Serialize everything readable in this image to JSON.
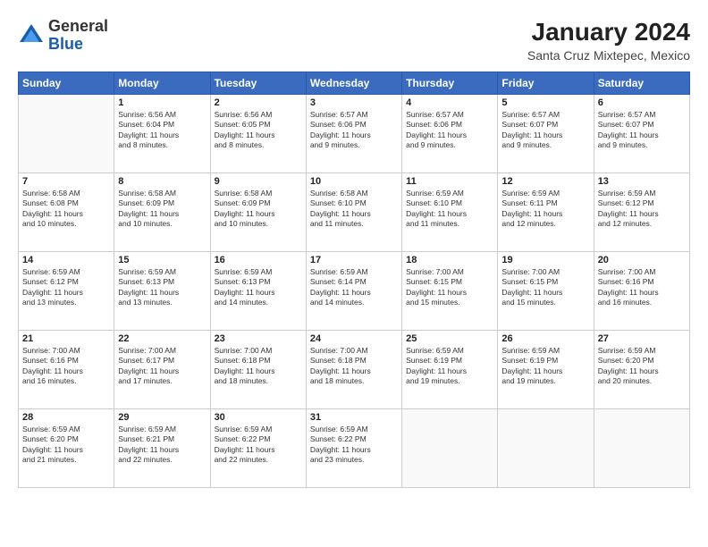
{
  "logo": {
    "general": "General",
    "blue": "Blue"
  },
  "title": {
    "month_year": "January 2024",
    "location": "Santa Cruz Mixtepec, Mexico"
  },
  "days_of_week": [
    "Sunday",
    "Monday",
    "Tuesday",
    "Wednesday",
    "Thursday",
    "Friday",
    "Saturday"
  ],
  "weeks": [
    [
      {
        "day": "",
        "info": []
      },
      {
        "day": "1",
        "info": [
          "Sunrise: 6:56 AM",
          "Sunset: 6:04 PM",
          "Daylight: 11 hours",
          "and 8 minutes."
        ]
      },
      {
        "day": "2",
        "info": [
          "Sunrise: 6:56 AM",
          "Sunset: 6:05 PM",
          "Daylight: 11 hours",
          "and 8 minutes."
        ]
      },
      {
        "day": "3",
        "info": [
          "Sunrise: 6:57 AM",
          "Sunset: 6:06 PM",
          "Daylight: 11 hours",
          "and 9 minutes."
        ]
      },
      {
        "day": "4",
        "info": [
          "Sunrise: 6:57 AM",
          "Sunset: 6:06 PM",
          "Daylight: 11 hours",
          "and 9 minutes."
        ]
      },
      {
        "day": "5",
        "info": [
          "Sunrise: 6:57 AM",
          "Sunset: 6:07 PM",
          "Daylight: 11 hours",
          "and 9 minutes."
        ]
      },
      {
        "day": "6",
        "info": [
          "Sunrise: 6:57 AM",
          "Sunset: 6:07 PM",
          "Daylight: 11 hours",
          "and 9 minutes."
        ]
      }
    ],
    [
      {
        "day": "7",
        "info": [
          "Sunrise: 6:58 AM",
          "Sunset: 6:08 PM",
          "Daylight: 11 hours",
          "and 10 minutes."
        ]
      },
      {
        "day": "8",
        "info": [
          "Sunrise: 6:58 AM",
          "Sunset: 6:09 PM",
          "Daylight: 11 hours",
          "and 10 minutes."
        ]
      },
      {
        "day": "9",
        "info": [
          "Sunrise: 6:58 AM",
          "Sunset: 6:09 PM",
          "Daylight: 11 hours",
          "and 10 minutes."
        ]
      },
      {
        "day": "10",
        "info": [
          "Sunrise: 6:58 AM",
          "Sunset: 6:10 PM",
          "Daylight: 11 hours",
          "and 11 minutes."
        ]
      },
      {
        "day": "11",
        "info": [
          "Sunrise: 6:59 AM",
          "Sunset: 6:10 PM",
          "Daylight: 11 hours",
          "and 11 minutes."
        ]
      },
      {
        "day": "12",
        "info": [
          "Sunrise: 6:59 AM",
          "Sunset: 6:11 PM",
          "Daylight: 11 hours",
          "and 12 minutes."
        ]
      },
      {
        "day": "13",
        "info": [
          "Sunrise: 6:59 AM",
          "Sunset: 6:12 PM",
          "Daylight: 11 hours",
          "and 12 minutes."
        ]
      }
    ],
    [
      {
        "day": "14",
        "info": [
          "Sunrise: 6:59 AM",
          "Sunset: 6:12 PM",
          "Daylight: 11 hours",
          "and 13 minutes."
        ]
      },
      {
        "day": "15",
        "info": [
          "Sunrise: 6:59 AM",
          "Sunset: 6:13 PM",
          "Daylight: 11 hours",
          "and 13 minutes."
        ]
      },
      {
        "day": "16",
        "info": [
          "Sunrise: 6:59 AM",
          "Sunset: 6:13 PM",
          "Daylight: 11 hours",
          "and 14 minutes."
        ]
      },
      {
        "day": "17",
        "info": [
          "Sunrise: 6:59 AM",
          "Sunset: 6:14 PM",
          "Daylight: 11 hours",
          "and 14 minutes."
        ]
      },
      {
        "day": "18",
        "info": [
          "Sunrise: 7:00 AM",
          "Sunset: 6:15 PM",
          "Daylight: 11 hours",
          "and 15 minutes."
        ]
      },
      {
        "day": "19",
        "info": [
          "Sunrise: 7:00 AM",
          "Sunset: 6:15 PM",
          "Daylight: 11 hours",
          "and 15 minutes."
        ]
      },
      {
        "day": "20",
        "info": [
          "Sunrise: 7:00 AM",
          "Sunset: 6:16 PM",
          "Daylight: 11 hours",
          "and 16 minutes."
        ]
      }
    ],
    [
      {
        "day": "21",
        "info": [
          "Sunrise: 7:00 AM",
          "Sunset: 6:16 PM",
          "Daylight: 11 hours",
          "and 16 minutes."
        ]
      },
      {
        "day": "22",
        "info": [
          "Sunrise: 7:00 AM",
          "Sunset: 6:17 PM",
          "Daylight: 11 hours",
          "and 17 minutes."
        ]
      },
      {
        "day": "23",
        "info": [
          "Sunrise: 7:00 AM",
          "Sunset: 6:18 PM",
          "Daylight: 11 hours",
          "and 18 minutes."
        ]
      },
      {
        "day": "24",
        "info": [
          "Sunrise: 7:00 AM",
          "Sunset: 6:18 PM",
          "Daylight: 11 hours",
          "and 18 minutes."
        ]
      },
      {
        "day": "25",
        "info": [
          "Sunrise: 6:59 AM",
          "Sunset: 6:19 PM",
          "Daylight: 11 hours",
          "and 19 minutes."
        ]
      },
      {
        "day": "26",
        "info": [
          "Sunrise: 6:59 AM",
          "Sunset: 6:19 PM",
          "Daylight: 11 hours",
          "and 19 minutes."
        ]
      },
      {
        "day": "27",
        "info": [
          "Sunrise: 6:59 AM",
          "Sunset: 6:20 PM",
          "Daylight: 11 hours",
          "and 20 minutes."
        ]
      }
    ],
    [
      {
        "day": "28",
        "info": [
          "Sunrise: 6:59 AM",
          "Sunset: 6:20 PM",
          "Daylight: 11 hours",
          "and 21 minutes."
        ]
      },
      {
        "day": "29",
        "info": [
          "Sunrise: 6:59 AM",
          "Sunset: 6:21 PM",
          "Daylight: 11 hours",
          "and 22 minutes."
        ]
      },
      {
        "day": "30",
        "info": [
          "Sunrise: 6:59 AM",
          "Sunset: 6:22 PM",
          "Daylight: 11 hours",
          "and 22 minutes."
        ]
      },
      {
        "day": "31",
        "info": [
          "Sunrise: 6:59 AM",
          "Sunset: 6:22 PM",
          "Daylight: 11 hours",
          "and 23 minutes."
        ]
      },
      {
        "day": "",
        "info": []
      },
      {
        "day": "",
        "info": []
      },
      {
        "day": "",
        "info": []
      }
    ]
  ]
}
